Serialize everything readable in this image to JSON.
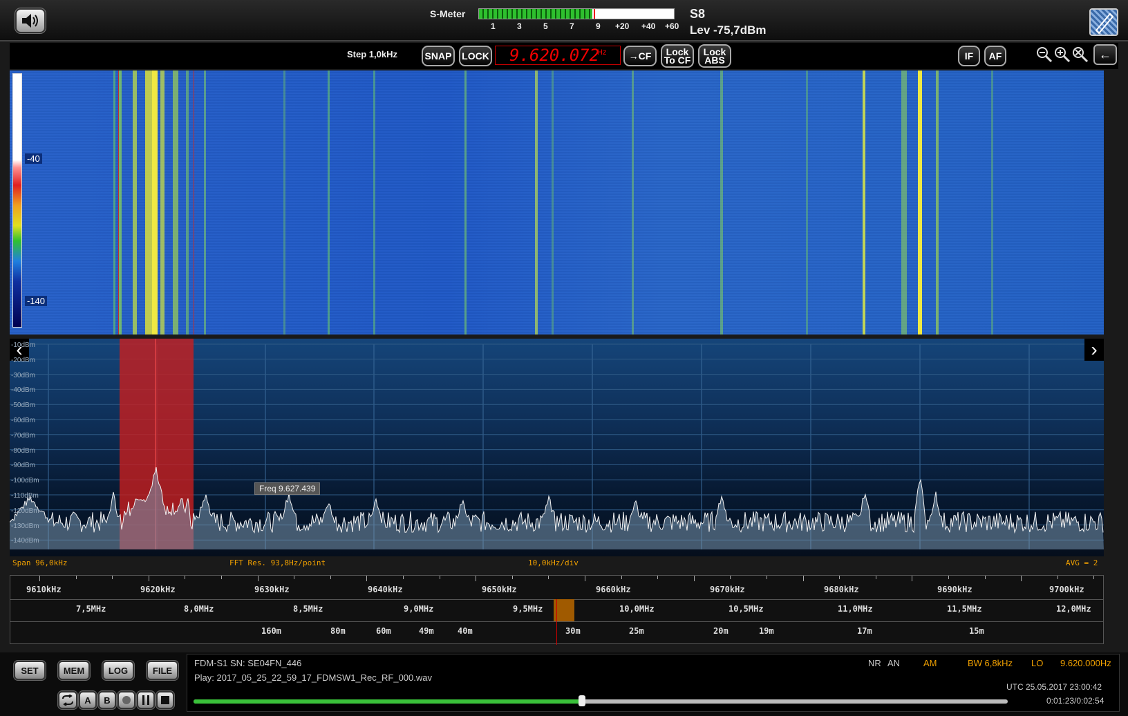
{
  "top": {
    "smeter_label": "S-Meter",
    "smeter_scale": [
      "1",
      "3",
      "5",
      "7",
      "9",
      "+20",
      "+40",
      "+60"
    ],
    "smeter_level": 0.58,
    "s_value": "S8",
    "level": "Lev -75,7dBm"
  },
  "toolbar": {
    "step": "Step 1,0kHz",
    "snap": "SNAP",
    "lock": "LOCK",
    "frequency": "9.620.072",
    "frequency_unit": "Hz",
    "to_cf": "→CF",
    "lock_to_cf_1": "Lock",
    "lock_to_cf_2": "To CF",
    "lock_abs_1": "Lock",
    "lock_abs_2": "ABS",
    "if": "IF",
    "af": "AF",
    "back": "←"
  },
  "waterfall": {
    "colorbar_labels": [
      "-40",
      "-140"
    ]
  },
  "spectrum": {
    "db_labels": [
      "-10dBm",
      "-20dBm",
      "-30dBm",
      "-40dBm",
      "-50dBm",
      "-60dBm",
      "-70dBm",
      "-80dBm",
      "-90dBm",
      "-100dBm",
      "-110dBm",
      "-120dBm",
      "-130dBm",
      "-140dBm"
    ],
    "tooltip": "Freq 9.627.439",
    "span": "Span 96,0kHz",
    "fft_res": "FFT Res. 93,8Hz/point",
    "div": "10,0kHz/div",
    "avg": "AVG = 2",
    "passband_color": "#c81e1e"
  },
  "scales": {
    "khz": [
      "9610kHz",
      "9620kHz",
      "9630kHz",
      "9640kHz",
      "9650kHz",
      "9660kHz",
      "9670kHz",
      "9680kHz",
      "9690kHz",
      "9700kHz"
    ],
    "mhz": [
      "7,5MHz",
      "8,0MHz",
      "8,5MHz",
      "9,0MHz",
      "9,5MHz",
      "10,0MHz",
      "10,5MHz",
      "11,0MHz",
      "11,5MHz",
      "12,0MHz"
    ],
    "bands": [
      "160m",
      "80m",
      "60m",
      "49m",
      "40m",
      "30m",
      "25m",
      "20m",
      "19m",
      "17m",
      "15m"
    ]
  },
  "bottom": {
    "buttons": [
      "SET",
      "MEM",
      "LOG",
      "FILE"
    ],
    "transport": [
      "A",
      "B"
    ],
    "device": "FDM-S1 SN: SE04FN_446",
    "play": "Play: 2017_05_25_22_59_17_FDMSW1_Rec_RF_000.wav",
    "nr": "NR",
    "an": "AN",
    "mode": "AM",
    "bw": "BW 6,8kHz",
    "lo_label": "LO",
    "lo_value": "9.620.000Hz",
    "utc": "UTC 25.05.2017 23:00:42",
    "time": "0:01:23/0:02:54",
    "progress": 0.477
  }
}
